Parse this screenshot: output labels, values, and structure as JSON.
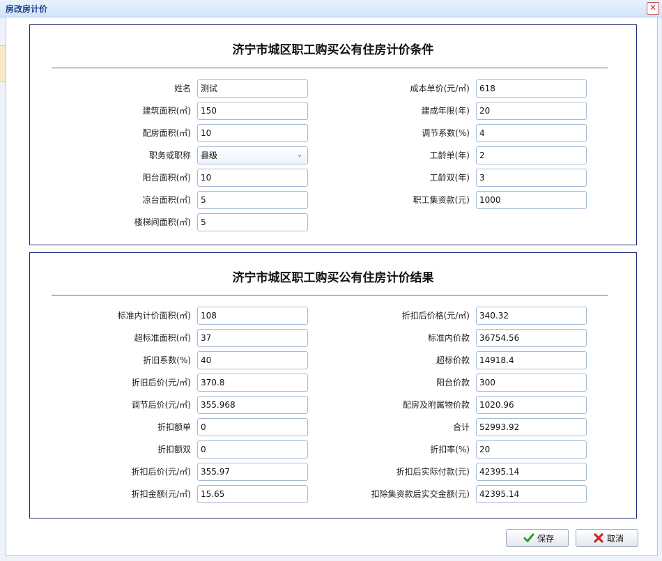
{
  "window": {
    "title": "房改房计价"
  },
  "conditions": {
    "title": "济宁市城区职工购买公有住房计价条件",
    "left": [
      {
        "label": "姓名",
        "value": "测试"
      },
      {
        "label": "建筑面积(㎡)",
        "value": "150"
      },
      {
        "label": "配房面积(㎡)",
        "value": "10"
      },
      {
        "label": "职务或职称",
        "value": "县级",
        "type": "select"
      },
      {
        "label": "阳台面积(㎡)",
        "value": "10"
      },
      {
        "label": "凉台面积(㎡)",
        "value": "5"
      },
      {
        "label": "楼梯间面积(㎡)",
        "value": "5"
      }
    ],
    "right": [
      {
        "label": "成本单价(元/㎡)",
        "value": "618"
      },
      {
        "label": "建成年限(年)",
        "value": "20"
      },
      {
        "label": "调节系数(%)",
        "value": "4"
      },
      {
        "label": "工龄单(年)",
        "value": "2"
      },
      {
        "label": "工龄双(年)",
        "value": "3"
      },
      {
        "label": "职工集资款(元)",
        "value": "1000"
      }
    ]
  },
  "results": {
    "title": "济宁市城区职工购买公有住房计价结果",
    "left": [
      {
        "label": "标准内计价面积(㎡)",
        "value": "108"
      },
      {
        "label": "超标准面积(㎡)",
        "value": "37"
      },
      {
        "label": "折旧系数(%)",
        "value": "40"
      },
      {
        "label": "折旧后价(元/㎡)",
        "value": "370.8"
      },
      {
        "label": "调节后价(元/㎡)",
        "value": "355.968"
      },
      {
        "label": "折扣额单",
        "value": "0"
      },
      {
        "label": "折扣额双",
        "value": "0"
      },
      {
        "label": "折扣后价(元/㎡)",
        "value": "355.97"
      },
      {
        "label": "折扣金额(元/㎡)",
        "value": "15.65"
      }
    ],
    "right": [
      {
        "label": "折扣后价格(元/㎡)",
        "value": "340.32"
      },
      {
        "label": "标准内价款",
        "value": "36754.56"
      },
      {
        "label": "超标价款",
        "value": "14918.4"
      },
      {
        "label": "阳台价款",
        "value": "300"
      },
      {
        "label": "配房及附属物价款",
        "value": "1020.96"
      },
      {
        "label": "合计",
        "value": "52993.92"
      },
      {
        "label": "折扣率(%)",
        "value": "20"
      },
      {
        "label": "折扣后实际付款(元)",
        "value": "42395.14"
      },
      {
        "label": "扣除集资款后实交金额(元)",
        "value": "42395.14"
      }
    ]
  },
  "buttons": {
    "save": "保存",
    "cancel": "取消"
  },
  "icons": {
    "close": "close-icon",
    "save": "check-icon",
    "cancel": "cross-icon",
    "select": "chevron-down-icon"
  }
}
